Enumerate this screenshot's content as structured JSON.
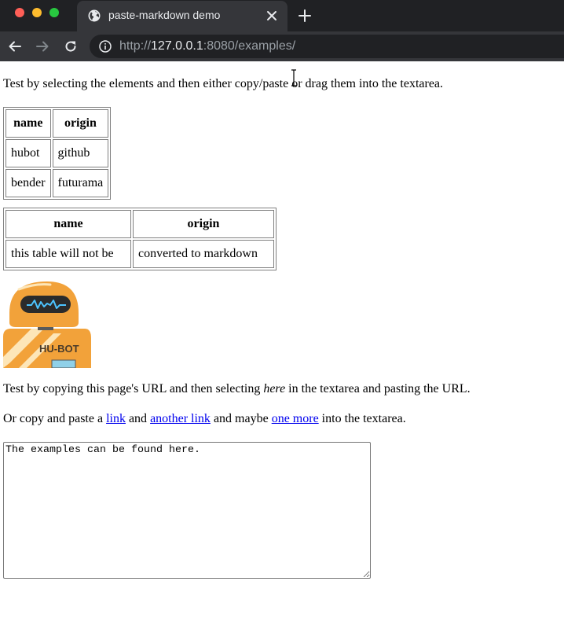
{
  "browser": {
    "tab_title": "paste-markdown demo",
    "url_scheme": "http://",
    "url_host": "127.0.0.1",
    "url_rest": ":8080/examples/"
  },
  "page": {
    "intro": "Test by selecting the elements and then either copy/paste or drag them into the textarea.",
    "table1": {
      "headers": [
        "name",
        "origin"
      ],
      "rows": [
        [
          "hubot",
          "github"
        ],
        [
          "bender",
          "futurama"
        ]
      ]
    },
    "table2": {
      "headers": [
        "name",
        "origin"
      ],
      "rows": [
        [
          "this table will not be",
          "converted to markdown"
        ]
      ]
    },
    "image_label": "HU-BOT",
    "url_tip": {
      "before": "Test by copying this page's URL and then selecting ",
      "emphasis": "here",
      "after": " in the textarea and pasting the URL."
    },
    "links_tip": {
      "t1": "Or copy and paste a ",
      "link1": "link",
      "t2": " and ",
      "link2": "another link",
      "t3": " and maybe ",
      "link3": "one more",
      "t4": " into the textarea."
    },
    "textarea_value": "The examples can be found here."
  },
  "colors": {
    "chrome_dark": "#202124",
    "chrome_tab": "#35363a",
    "link": "#0000ee"
  }
}
